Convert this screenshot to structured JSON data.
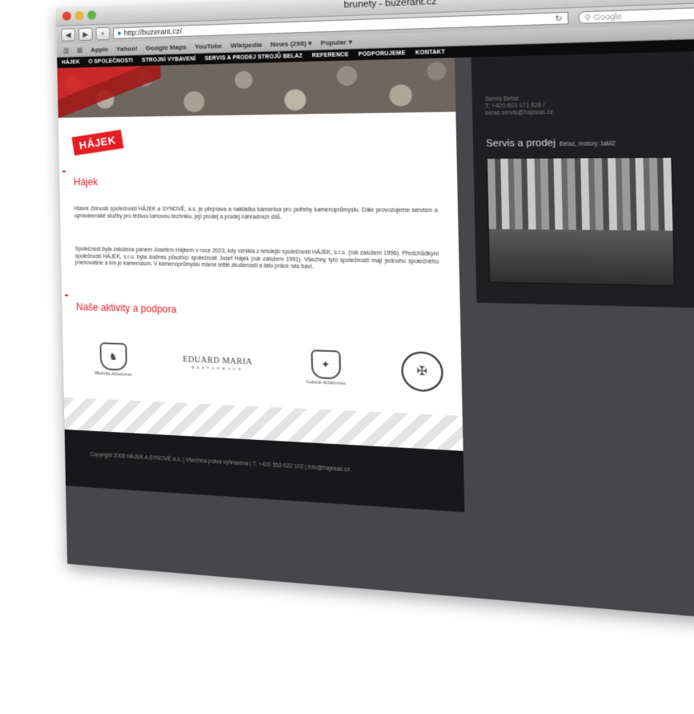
{
  "browser": {
    "title": "brunety - buzerant.cz",
    "url": "http://buzerant.cz/",
    "search_placeholder": "Google",
    "bookmarks": [
      "Apple",
      "Yahoo!",
      "Google Maps",
      "YouTube",
      "Wikipedia",
      "News (298) ▾",
      "Popular ▾"
    ]
  },
  "nav": [
    "HÁJEK",
    "O SPOLEČNOSTI",
    "STROJNÍ VYBAVENÍ",
    "SERVIS A PRODEJ STROJŮ BELAZ",
    "REFERENCE",
    "PODPORUJEME",
    "KONTAKT"
  ],
  "logo": "HÁJEK",
  "section1_title": "Hájek",
  "para1": "Hlavní činností společnosti HÁJEK a SYNOVÉ, a.s. je přeprava a nakládka kameniva pro potřeby kamenoprůmyslu. Dále provozujeme servisní a opravárenské služby pro těžkou lomovou techniku, její prodej a prodej náhradních dílů.",
  "para2": "Společnost byla založena panem Josefem Hájkem v roce 2003, kdy vznikla z tehdejší společnosti HÁJEK, s.r.o. (rok založení 1996). Předchůdkyní společnosti HÁJEK, s.r.o. byla dodnes působící společnost Josef Hájek (rok založení 1991). Všechny tyto společnosti mají jednoho společného jmenovatele a tím je kamenolom. V kamenoprůmyslu máme letité zkušenosti a tato práce nás baví.",
  "section2_title": "Naše aktivity a podpora",
  "partners": {
    "p1": "Hřebčín Albertovec",
    "p2_main": "EDUARD MARIA",
    "p2_sub": "RESTAURACE",
    "p3": "Galerie Albertovec"
  },
  "servis": {
    "line1": "Servis Belaz",
    "line2": "T: +420 603 171 828 /",
    "line3": "belaz.servis@hajekas.cz",
    "heading": "Servis a prodej",
    "heading_small": "Belaz, motory JaMZ"
  },
  "footer": "Copyright 2008 HÁJEK A SYNOVÉ a.s. | Všechna práva vyhrazena | T: +420 553 622 102 | info@hajekas.cz",
  "colors": {
    "accent_red": "#e31e24",
    "page_bg": "#47474b",
    "panel_dark": "#1f1f22"
  }
}
